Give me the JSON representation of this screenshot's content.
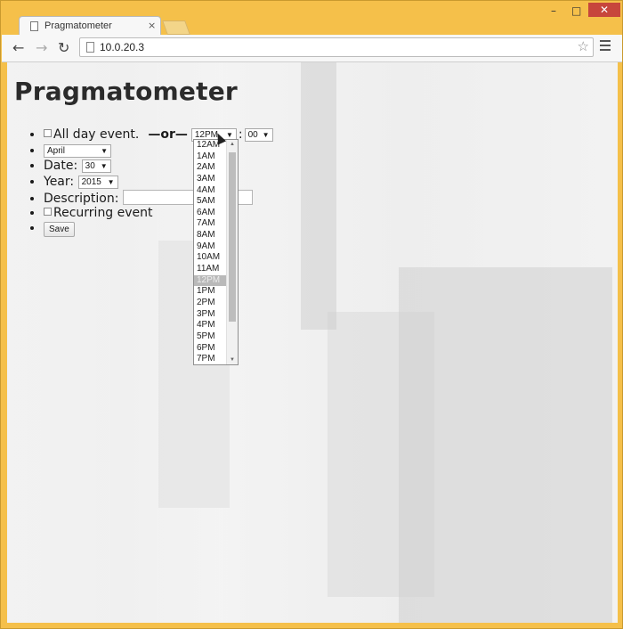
{
  "browser": {
    "tab_title": "Pragmatometer",
    "tab_close": "×",
    "url": "10.0.20.3",
    "window_controls": {
      "minimize": "–",
      "maximize": "□",
      "close": "✕"
    }
  },
  "page": {
    "heading": "Pragmatometer",
    "all_day_label": "All day event.",
    "or_label": "—or—",
    "hour_value": "12PM",
    "colon": ":",
    "minute_value": "00",
    "month_value": "April",
    "date_label": "Date:",
    "date_value": "30",
    "year_label": "Year:",
    "year_value": "2015",
    "description_label": "Description:",
    "description_value": "",
    "recurring_label": "Recurring event",
    "save_label": "Save"
  },
  "hour_dropdown": {
    "options": [
      "12AM",
      "1AM",
      "2AM",
      "3AM",
      "4AM",
      "5AM",
      "6AM",
      "7AM",
      "8AM",
      "9AM",
      "10AM",
      "11AM",
      "12PM",
      "1PM",
      "2PM",
      "3PM",
      "4PM",
      "5PM",
      "6PM",
      "7PM"
    ],
    "selected": "12PM"
  }
}
